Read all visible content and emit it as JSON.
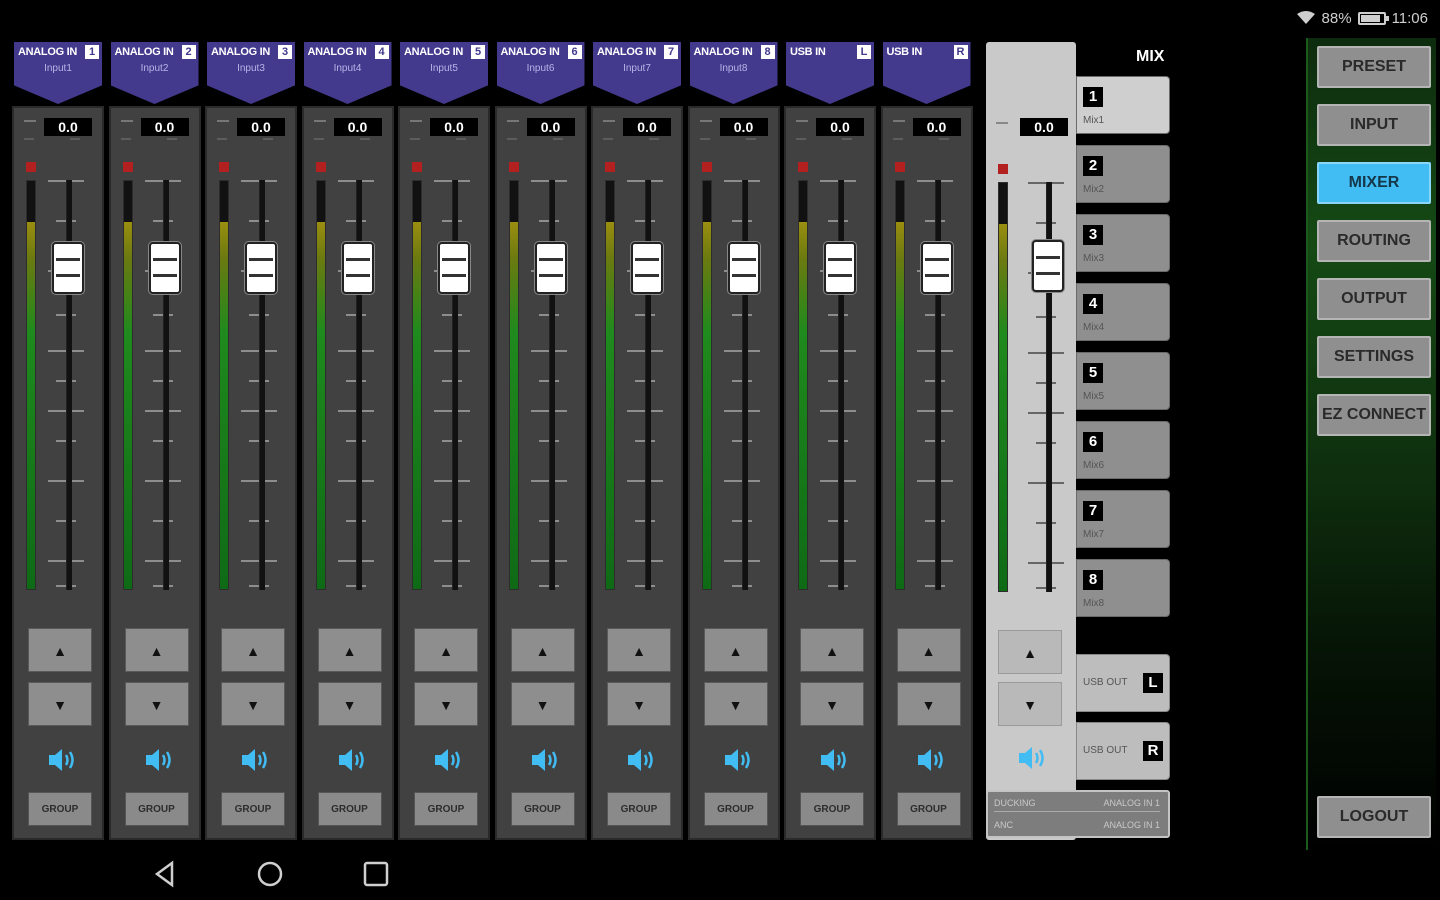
{
  "status": {
    "battery": "88%",
    "time": "11:06",
    "battery_fraction": 0.88
  },
  "channels": [
    {
      "name": "ANALOG IN",
      "num": "1",
      "sub": "Input1",
      "gain": "0.0",
      "level": 0.9
    },
    {
      "name": "ANALOG IN",
      "num": "2",
      "sub": "Input2",
      "gain": "0.0",
      "level": 0.9
    },
    {
      "name": "ANALOG IN",
      "num": "3",
      "sub": "Input3",
      "gain": "0.0",
      "level": 0.9
    },
    {
      "name": "ANALOG IN",
      "num": "4",
      "sub": "Input4",
      "gain": "0.0",
      "level": 0.9
    },
    {
      "name": "ANALOG IN",
      "num": "5",
      "sub": "Input5",
      "gain": "0.0",
      "level": 0.9
    },
    {
      "name": "ANALOG IN",
      "num": "6",
      "sub": "Input6",
      "gain": "0.0",
      "level": 0.9
    },
    {
      "name": "ANALOG IN",
      "num": "7",
      "sub": "Input7",
      "gain": "0.0",
      "level": 0.9
    },
    {
      "name": "ANALOG IN",
      "num": "8",
      "sub": "Input8",
      "gain": "0.0",
      "level": 0.9
    },
    {
      "name": "USB IN",
      "num": "L",
      "sub": "",
      "gain": "0.0",
      "level": 0.9
    },
    {
      "name": "USB IN",
      "num": "R",
      "sub": "",
      "gain": "0.0",
      "level": 0.9
    }
  ],
  "buttons": {
    "up": "▲",
    "down": "▼",
    "group": "GROUP"
  },
  "mix": {
    "label": "MIX",
    "gain": "0.0",
    "level": 0.9,
    "items": [
      {
        "num": "1",
        "name": "Mix1"
      },
      {
        "num": "2",
        "name": "Mix2"
      },
      {
        "num": "3",
        "name": "Mix3"
      },
      {
        "num": "4",
        "name": "Mix4"
      },
      {
        "num": "5",
        "name": "Mix5"
      },
      {
        "num": "6",
        "name": "Mix6"
      },
      {
        "num": "7",
        "name": "Mix7"
      },
      {
        "num": "8",
        "name": "Mix8"
      }
    ],
    "usb_out": [
      {
        "label": "USB OUT",
        "ch": "L"
      },
      {
        "label": "USB OUT",
        "ch": "R"
      }
    ],
    "ducking": {
      "label1": "DUCKING",
      "value1": "ANALOG IN 1",
      "label2": "ANC",
      "value2": "ANALOG IN 1"
    }
  },
  "nav": {
    "items": [
      "PRESET",
      "INPUT",
      "MIXER",
      "ROUTING",
      "OUTPUT",
      "SETTINGS",
      "EZ CONNECT"
    ],
    "logout": "LOGOUT"
  },
  "colors": {
    "header": "#433a8e",
    "active": "#41bdf4",
    "speaker": "#41bdf4"
  }
}
